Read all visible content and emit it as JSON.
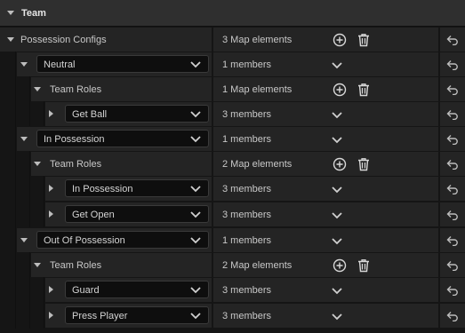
{
  "section": {
    "title": "Team"
  },
  "colors": {
    "row_bg": "#242424",
    "combo_bg": "#0e0e0e",
    "text": "#c8c8c8",
    "divider": "#151515"
  },
  "icons": {
    "expand": "chevron-down-icon",
    "collapsed": "chevron-right-icon",
    "add": "plus-circle-icon",
    "delete": "trash-icon",
    "reset": "reset-arrow-icon"
  },
  "rows": [
    {
      "kind": "header",
      "label": "Possession Configs",
      "value": "3 Map elements"
    },
    {
      "kind": "key",
      "label": "Neutral",
      "value": "1 members"
    },
    {
      "kind": "roles",
      "label": "Team Roles",
      "value": "1 Map elements"
    },
    {
      "kind": "role",
      "label": "Get Ball",
      "value": "3 members"
    },
    {
      "kind": "key",
      "label": "In Possession",
      "value": "1 members"
    },
    {
      "kind": "roles",
      "label": "Team Roles",
      "value": "2 Map elements"
    },
    {
      "kind": "role",
      "label": "In Possession",
      "value": "3 members"
    },
    {
      "kind": "role",
      "label": "Get Open",
      "value": "3 members"
    },
    {
      "kind": "key",
      "label": "Out Of Possession",
      "value": "1 members"
    },
    {
      "kind": "roles",
      "label": "Team Roles",
      "value": "2 Map elements"
    },
    {
      "kind": "role",
      "label": "Guard",
      "value": "3 members"
    },
    {
      "kind": "role",
      "label": "Press Player",
      "value": "3 members"
    }
  ]
}
